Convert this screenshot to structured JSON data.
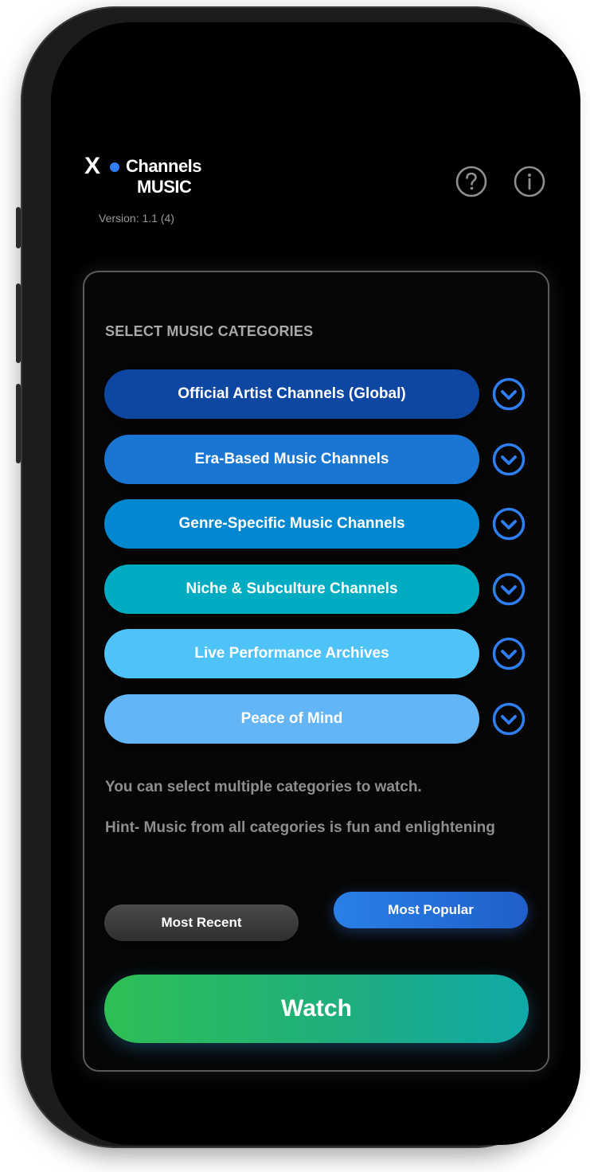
{
  "app": {
    "logo_x": "X",
    "logo_channels": "Channels",
    "logo_music": "MUSIC",
    "version": "Version: 1.1 (4)",
    "header_icons": [
      "help-icon",
      "info-icon"
    ]
  },
  "panel": {
    "title": "SELECT MUSIC CATEGORIES",
    "categories": [
      {
        "label": "Official Artist Channels (Global)",
        "color": "#0d47a1"
      },
      {
        "label": "Era-Based Music Channels",
        "color": "#1976d2"
      },
      {
        "label": "Genre-Specific Music Channels",
        "color": "#0288d1"
      },
      {
        "label": "Niche & Subculture Channels",
        "color": "#00acc1"
      },
      {
        "label": "Live Performance Archives",
        "color": "#4fc3f7"
      },
      {
        "label": "Peace of Mind",
        "color": "#64b5f6"
      }
    ],
    "hint_multi": "You can select multiple categories to watch.",
    "hint_fun": "Hint- Music from all categories is fun and enlightening"
  },
  "sort": {
    "recent_label": "Most Recent",
    "popular_label": "Most Popular",
    "selected": "Most Popular"
  },
  "watch_label": "Watch",
  "colors": {
    "accent": "#2f7ff2",
    "chevron": "#2f7ff2",
    "watch_start": "#2fbf55",
    "watch_end": "#10a9a8"
  }
}
